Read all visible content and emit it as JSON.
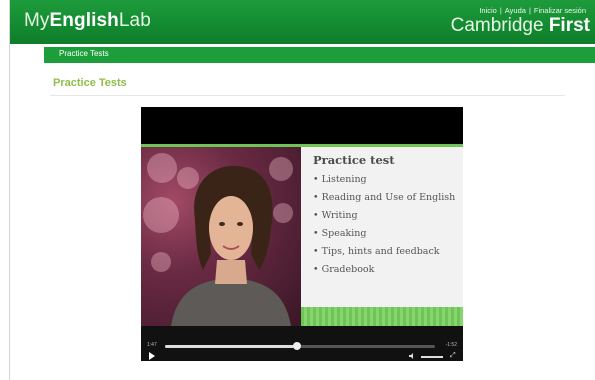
{
  "header": {
    "logo_my": "My",
    "logo_english": "English",
    "logo_lab": "Lab",
    "links": [
      "Inicio",
      "Ayuda",
      "Finalizar sesión"
    ],
    "brand_cambridge": "Cambridge",
    "brand_first": "First"
  },
  "subnav": {
    "label": "Practice Tests"
  },
  "page": {
    "title": "Practice Tests"
  },
  "video": {
    "slide_title": "Practice test",
    "slide_items": [
      "• Listening",
      "• Reading and Use of English",
      "• Writing",
      "• Speaking",
      "• Tips, hints and feedback",
      "• Gradebook"
    ],
    "elapsed": "1:47",
    "remaining": "-1:52",
    "progress_fraction": 0.49
  },
  "colors": {
    "brand_green": "#138a30",
    "accent_green": "#8fbf4a"
  }
}
